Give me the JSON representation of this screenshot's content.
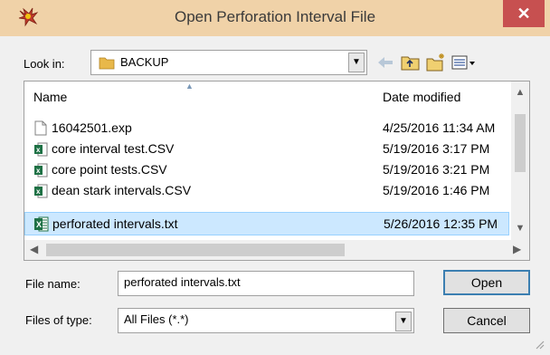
{
  "window": {
    "title": "Open Perforation Interval File",
    "close_glyph": "✕"
  },
  "look_in": {
    "label": "Look in:",
    "value": "BACKUP",
    "arrow": "▼"
  },
  "toolbar": {
    "back_icon": "back-arrow-icon",
    "up_icon": "up-folder-icon",
    "new_folder_icon": "new-folder-icon",
    "views_icon": "view-menu-icon"
  },
  "columns": {
    "name": "Name",
    "date": "Date modified"
  },
  "files": [
    {
      "name": "16042501.exp",
      "date": "4/25/2016 11:34 AM",
      "icon": "blank-file-icon"
    },
    {
      "name": "core interval test.CSV",
      "date": "5/19/2016 3:17 PM",
      "icon": "excel-csv-icon"
    },
    {
      "name": "core point tests.CSV",
      "date": "5/19/2016 3:21 PM",
      "icon": "excel-csv-icon"
    },
    {
      "name": "dean stark intervals.CSV",
      "date": "5/19/2016 1:46 PM",
      "icon": "excel-csv-icon"
    },
    {
      "name": "perforated intervals.txt",
      "date": "5/26/2016 12:35 PM",
      "icon": "excel-file-icon",
      "selected": true
    }
  ],
  "file_name": {
    "label": "File name:",
    "value": "perforated intervals.txt"
  },
  "file_type": {
    "label": "Files of type:",
    "value": "All Files (*.*)"
  },
  "buttons": {
    "open": "Open",
    "cancel": "Cancel"
  },
  "colors": {
    "selection": "#cce8ff",
    "titlebar": "#f0d2a8",
    "close": "#c75050"
  }
}
